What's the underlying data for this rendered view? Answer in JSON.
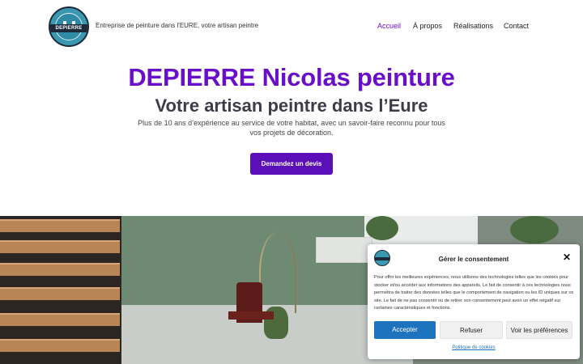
{
  "header": {
    "logo_text": "DEPIERRE",
    "tagline": "Entreprise de peinture dans l'EURE, votre artisan peintre",
    "nav": [
      {
        "label": "Accueil",
        "active": true
      },
      {
        "label": "À propos",
        "active": false
      },
      {
        "label": "Réalisations",
        "active": false
      },
      {
        "label": "Contact",
        "active": false
      }
    ]
  },
  "hero": {
    "title": "DEPIERRE Nicolas peinture",
    "subtitle": "Votre artisan peintre dans l’Eure",
    "description": "Plus de 10 ans d’expérience au service de votre habitat, avec un savoir-faire reconnu pour tous vos projets de décoration.",
    "cta_label": "Demandez un devis"
  },
  "cookie": {
    "title": "Gérer le consentement",
    "close_icon": "close-icon",
    "text": "Pour offrir les meilleures expériences, nous utilisons des technologies telles que les cookies pour stocker et/ou accéder aux informations des appareils. Le fait de consentir à ces technologies nous permettra de traiter des données telles que le comportement de navigation ou les ID uniques sur ce site. Le fait de ne pas consentir ou de retirer son consentement peut avoir un effet négatif sur certaines caractéristiques et fonctions.",
    "accept_label": "Accepter",
    "refuse_label": "Refuser",
    "prefs_label": "Voir les préférences",
    "policy_label": "Politique de cookies"
  },
  "colors": {
    "brand_purple": "#6a0fc9",
    "button_purple": "#5b0fb8",
    "accept_blue": "#1e73be"
  }
}
